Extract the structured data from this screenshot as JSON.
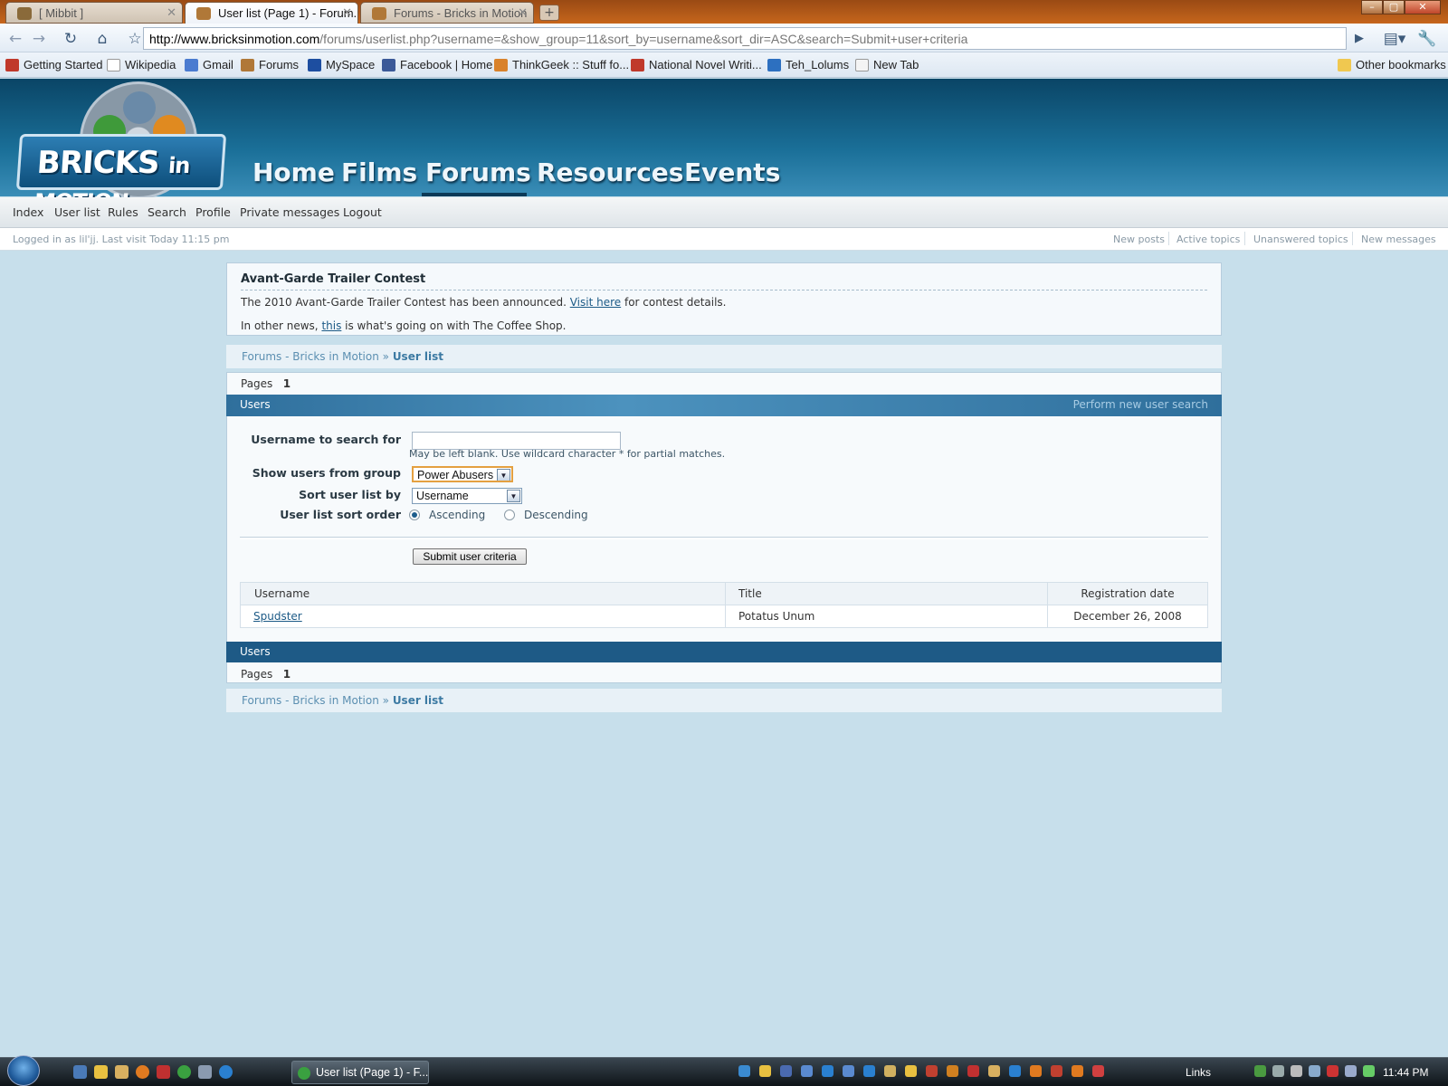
{
  "browser": {
    "tabs": [
      {
        "label": "[ Mibbit ]",
        "active": false
      },
      {
        "label": "User list (Page 1) - Forum...",
        "active": true
      },
      {
        "label": "Forums - Bricks in Motion",
        "active": false
      }
    ],
    "url_host": "http://www.bricksinmotion.com",
    "url_path": "/forums/userlist.php?username=&show_group=11&sort_by=username&sort_dir=ASC&search=Submit+user+criteria",
    "bookmarks": [
      {
        "label": "Getting Started",
        "icon": "firefox-icon",
        "color": "#c0392b"
      },
      {
        "label": "Wikipedia",
        "icon": "wikipedia-icon",
        "color": "#ffffff"
      },
      {
        "label": "Gmail",
        "icon": "gmail-icon",
        "color": "#4a7bd0"
      },
      {
        "label": "Forums",
        "icon": "forum-icon",
        "color": "#b07838"
      },
      {
        "label": "MySpace",
        "icon": "myspace-icon",
        "color": "#1d4ea0"
      },
      {
        "label": "Facebook | Home",
        "icon": "facebook-icon",
        "color": "#3b5998"
      },
      {
        "label": "ThinkGeek :: Stuff fo...",
        "icon": "thinkgeek-icon",
        "color": "#d9822b"
      },
      {
        "label": "National Novel Writi...",
        "icon": "nanowrimo-icon",
        "color": "#c0392b"
      },
      {
        "label": "Teh_Lolums",
        "icon": "globe-icon",
        "color": "#2d70c0"
      },
      {
        "label": "New Tab",
        "icon": "page-icon",
        "color": "#f4f4f4"
      }
    ],
    "other_bookmarks": "Other bookmarks"
  },
  "site": {
    "logo_text_1": "BRICKS",
    "logo_text_2": "in MOTION",
    "main_nav": [
      "Home",
      "Films",
      "Forums",
      "Resources",
      "Events"
    ],
    "sub_nav": [
      "Index",
      "User list",
      "Rules",
      "Search",
      "Profile",
      "Private messages",
      "Logout"
    ],
    "status_left": "Logged in as lil'jj. Last visit Today 11:15 pm",
    "status_links": [
      "New posts",
      "Active topics",
      "Unanswered topics",
      "New messages"
    ]
  },
  "announcement": {
    "title": "Avant-Garde Trailer Contest",
    "line1_before": "The 2010 Avant-Garde Trailer Contest has been announced. ",
    "line1_link": "Visit here",
    "line1_after": " for contest details.",
    "line2_before": "In other news, ",
    "line2_link": "this",
    "line2_after": " is what's going on with The Coffee Shop."
  },
  "breadcrumb": {
    "root": "Forums - Bricks in Motion",
    "sep": "»",
    "current": "User list"
  },
  "pages": {
    "label": "Pages",
    "current": "1"
  },
  "users_section": {
    "title": "Users",
    "new_search_link": "Perform new user search"
  },
  "search_form": {
    "username_label": "Username to search for",
    "username_value": "",
    "username_hint": "May be left blank. Use wildcard character * for partial matches.",
    "group_label": "Show users from group",
    "group_value": "Power Abusers",
    "sort_by_label": "Sort user list by",
    "sort_by_value": "Username",
    "sort_order_label": "User list sort order",
    "ascending_label": "Ascending",
    "descending_label": "Descending",
    "selected_order": "Ascending",
    "submit_label": "Submit user criteria"
  },
  "user_table": {
    "headers": [
      "Username",
      "Title",
      "Registration date"
    ],
    "rows": [
      {
        "username": "Spudster",
        "title": "Potatus Unum",
        "registered": "December 26, 2008"
      }
    ]
  },
  "taskbar": {
    "active_window": "User list (Page 1) - F...",
    "links_label": "Links",
    "clock": "11:44 PM"
  }
}
